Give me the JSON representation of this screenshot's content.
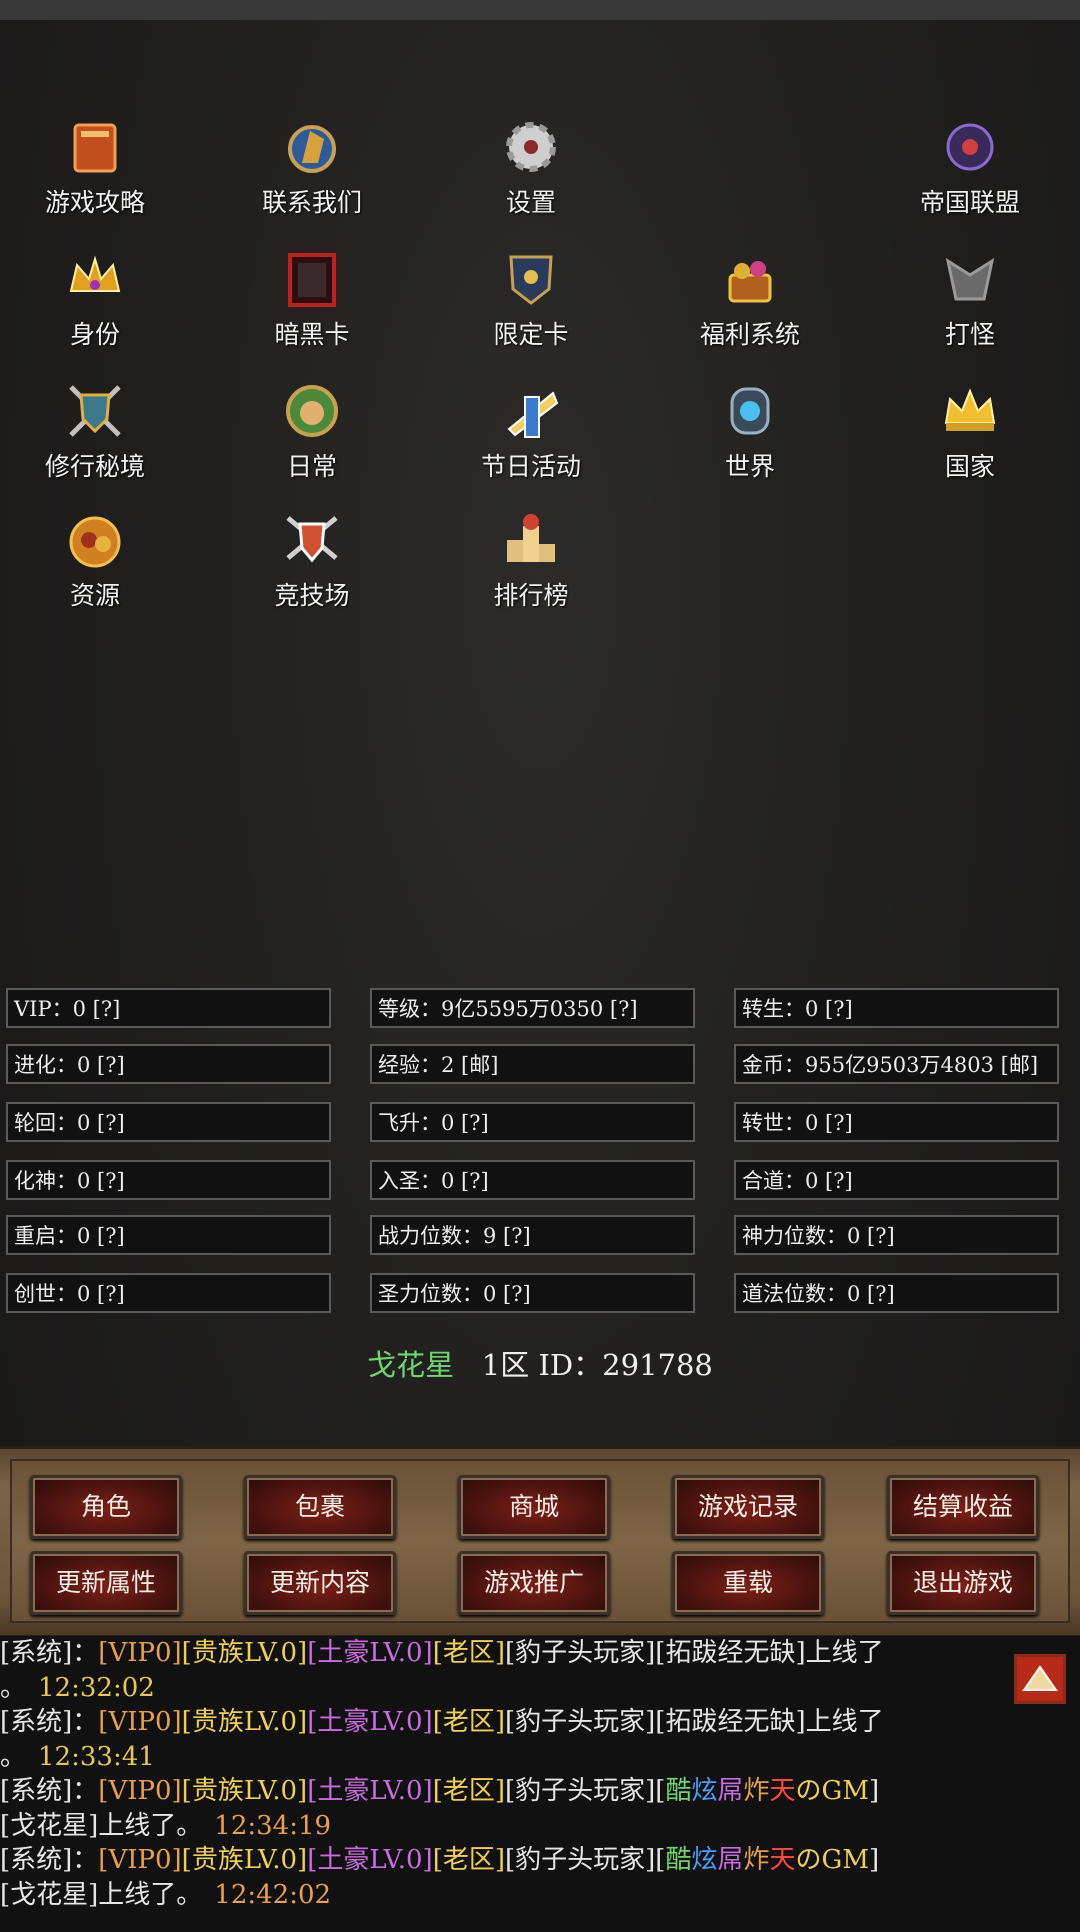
{
  "menu": [
    {
      "label": "游戏攻略",
      "icon": "book-icon"
    },
    {
      "label": "联系我们",
      "icon": "horse-head-icon"
    },
    {
      "label": "设置",
      "icon": "gear-icon"
    },
    {
      "label": "帝国联盟",
      "icon": "orb-emblem-icon"
    },
    {
      "label": "身份",
      "icon": "crown-icon"
    },
    {
      "label": "暗黑卡",
      "icon": "dark-card-icon"
    },
    {
      "label": "限定卡",
      "icon": "shield-card-icon"
    },
    {
      "label": "福利系统",
      "icon": "treasure-icon"
    },
    {
      "label": "打怪",
      "icon": "monster-icon"
    },
    {
      "label": "修行秘境",
      "icon": "crossed-weapons-shield-icon"
    },
    {
      "label": "日常",
      "icon": "warrior-face-icon"
    },
    {
      "label": "节日活动",
      "icon": "trumpet-icon"
    },
    {
      "label": "世界",
      "icon": "portal-icon"
    },
    {
      "label": "国家",
      "icon": "gold-crown-icon"
    },
    {
      "label": "资源",
      "icon": "resource-pile-icon"
    },
    {
      "label": "竞技场",
      "icon": "arena-shield-icon"
    },
    {
      "label": "排行榜",
      "icon": "podium-icon"
    }
  ],
  "stats": [
    [
      "VIP：0 [?]",
      "等级：9亿5595万0350 [?]",
      "转生：0 [?]"
    ],
    [
      "进化：0 [?]",
      "经验：2 [邮]",
      "金币：955亿9503万4803 [邮]"
    ],
    [
      "轮回：0 [?]",
      "飞升：0 [?]",
      "转世：0 [?]"
    ],
    [
      "化神：0 [?]",
      "入圣：0 [?]",
      "合道：0 [?]"
    ],
    [
      "重启：0 [?]",
      "战力位数：9 [?]",
      "神力位数：0 [?]"
    ],
    [
      "创世：0 [?]",
      "圣力位数：0 [?]",
      "道法位数：0 [?]"
    ]
  ],
  "player": {
    "name": "戈花星",
    "rest": "1区 ID：291788"
  },
  "buttons": [
    [
      "角色",
      "包裹",
      "商城",
      "游戏记录",
      "结算收益"
    ],
    [
      "更新属性",
      "更新内容",
      "游戏推广",
      "重载",
      "退出游戏"
    ]
  ],
  "chat": [
    [
      [
        "[系统]：",
        "w"
      ],
      [
        "[VIP0]",
        "o"
      ],
      [
        "[贵族LV.0]",
        "y"
      ],
      [
        "[土豪LV.0]",
        "m"
      ],
      [
        "[老区]",
        "y"
      ],
      [
        "[豹子头玩家]",
        "w"
      ],
      [
        "[拓跋经无缺]上线了",
        "w"
      ]
    ],
    [
      [
        "。",
        "w"
      ],
      [
        "12:32:02",
        "t"
      ]
    ],
    [
      [
        "[系统]：",
        "w"
      ],
      [
        "[VIP0]",
        "o"
      ],
      [
        "[贵族LV.0]",
        "y"
      ],
      [
        "[土豪LV.0]",
        "m"
      ],
      [
        "[老区]",
        "y"
      ],
      [
        "[豹子头玩家]",
        "w"
      ],
      [
        "[拓跋经无缺]上线了",
        "w"
      ]
    ],
    [
      [
        "。",
        "w"
      ],
      [
        "12:33:41",
        "t"
      ]
    ],
    [
      [
        "[系统]：",
        "w"
      ],
      [
        "[VIP0]",
        "o"
      ],
      [
        "[贵族LV.0]",
        "y"
      ],
      [
        "[土豪LV.0]",
        "m"
      ],
      [
        "[老区]",
        "y"
      ],
      [
        "[豹子头玩家]",
        "w"
      ],
      [
        "[",
        "w"
      ],
      [
        "酷",
        "g"
      ],
      [
        "炫",
        "b"
      ],
      [
        "屌",
        "m"
      ],
      [
        "炸",
        "o"
      ],
      [
        "天",
        "r"
      ],
      [
        "の",
        "y"
      ],
      [
        "GM",
        "y"
      ],
      [
        "]",
        "w"
      ]
    ],
    [
      [
        "[戈花星]上线了。",
        "w"
      ],
      [
        "12:34:19",
        "o"
      ]
    ],
    [
      [
        "[系统]：",
        "w"
      ],
      [
        "[VIP0]",
        "o"
      ],
      [
        "[贵族LV.0]",
        "y"
      ],
      [
        "[土豪LV.0]",
        "m"
      ],
      [
        "[老区]",
        "y"
      ],
      [
        "[豹子头玩家]",
        "w"
      ],
      [
        "[",
        "w"
      ],
      [
        "酷",
        "g"
      ],
      [
        "炫",
        "b"
      ],
      [
        "屌",
        "m"
      ],
      [
        "炸",
        "o"
      ],
      [
        "天",
        "r"
      ],
      [
        "の",
        "y"
      ],
      [
        "GM",
        "y"
      ],
      [
        "]",
        "w"
      ]
    ],
    [
      [
        "[戈花星]上线了。",
        "w"
      ],
      [
        "12:42:02",
        "o"
      ]
    ]
  ]
}
